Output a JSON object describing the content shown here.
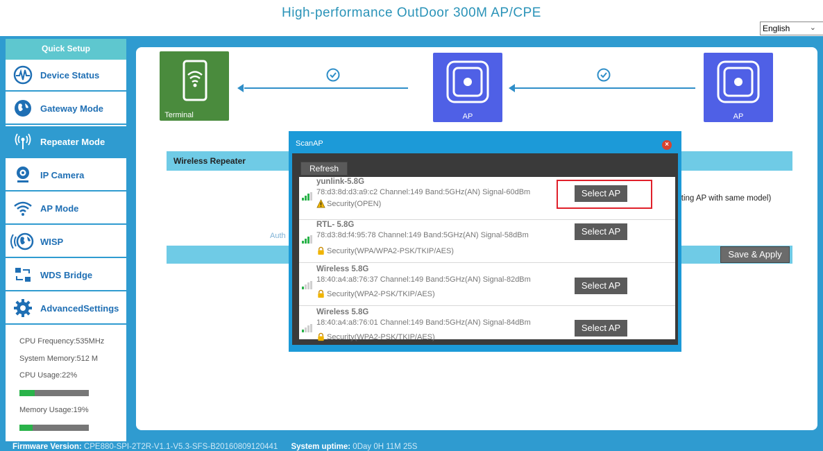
{
  "page_title": "High-performance OutDoor 300M AP/CPE",
  "language": "English",
  "sidebar": {
    "quick_setup": "Quick Setup",
    "items": [
      {
        "label": "Device Status",
        "icon": "pulse-icon"
      },
      {
        "label": "Gateway Mode",
        "icon": "globe-icon"
      },
      {
        "label": "Repeater Mode",
        "icon": "antenna-icon",
        "active": true
      },
      {
        "label": "IP Camera",
        "icon": "webcam-icon"
      },
      {
        "label": "AP Mode",
        "icon": "wifi-icon"
      },
      {
        "label": "WISP",
        "icon": "wisp-globe-icon"
      },
      {
        "label": "WDS Bridge",
        "icon": "wds-bridge-icon"
      },
      {
        "label": "AdvancedSettings",
        "icon": "gear-icon"
      }
    ],
    "system": {
      "cpu_frequency": "CPU Frequency:535MHz",
      "system_memory": "System Memory:512 M",
      "cpu_usage": "CPU Usage:22%",
      "cpu_usage_value": 22,
      "memory_usage": "Memory Usage:19%",
      "memory_usage_value": 19
    }
  },
  "diagram": {
    "terminal_label": "Terminal",
    "ap1_label": "AP",
    "ap2_label": "AP"
  },
  "wireless_repeater": {
    "header": "Wireless Repeater",
    "note_fragment": "cting AP with same model)",
    "auth_fragment": "Auth",
    "save_apply": "Save & Apply"
  },
  "scan_ap": {
    "title": "ScanAP",
    "refresh": "Refresh",
    "select_label": "Select AP",
    "aps": [
      {
        "name": "yunlink-5.8G",
        "details": "78:d3:8d:d3:a9:c2 Channel:149 Band:5GHz(AN) Signal-60dBm",
        "security": "Security(OPEN)",
        "security_icon": "warning-icon"
      },
      {
        "name": "RTL- 5.8G",
        "details": "78:d3:8d:f4:95:78 Channel:149 Band:5GHz(AN) Signal-58dBm",
        "security": "Security(WPA/WPA2-PSK/TKIP/AES)",
        "security_icon": "lock-icon"
      },
      {
        "name": "Wireless 5.8G",
        "details": "18:40:a4:a8:76:37 Channel:149 Band:5GHz(AN) Signal-82dBm",
        "security": "Security(WPA2-PSK/TKIP/AES)",
        "security_icon": "lock-icon"
      },
      {
        "name": "Wireless 5.8G",
        "details": "18:40:a4:a8:76:01 Channel:149 Band:5GHz(AN) Signal-84dBm",
        "security": "Security(WPA2-PSK/TKIP/AES)",
        "security_icon": "lock-icon"
      }
    ]
  },
  "footer": {
    "firmware_label": "Firmware Version:",
    "firmware_value": "CPE880-SPI-2T2R-V1.1-V5.3-SFS-B20160809120441",
    "uptime_label": "System uptime:",
    "uptime_value": "0Day 0H 11M 25S"
  },
  "colors": {
    "frame_blue": "#2f9bd0",
    "title_blue": "#2a93b8",
    "terminal_green": "#4a8b3d",
    "ap_blue": "#4f60e6",
    "highlight_red": "#e0202a"
  }
}
